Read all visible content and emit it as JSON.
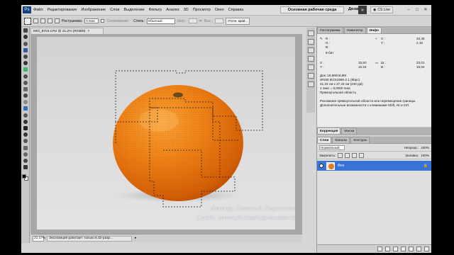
{
  "menubar": {
    "logo": "Ps",
    "items": [
      "Файл",
      "Редактирование",
      "Изображение",
      "Слои",
      "Выделение",
      "Фильтр",
      "Анализ",
      "3D",
      "Просмотр",
      "Окно",
      "Справка"
    ],
    "zoom": "21,2",
    "workspace": "Основная рабочая среда",
    "design": "Дизайн",
    "expand_arrow": "»",
    "cs_live": "CS Live"
  },
  "options": {
    "feather_label": "Растушевка:",
    "feather_value": "0 пикс",
    "antialias_label": "Сглаживание",
    "style_label": "Стиль:",
    "style_value": "Обычный",
    "width_label": "Шир.:",
    "height_label": "Выс.:",
    "refine_button": "Уточн. край..."
  },
  "document": {
    "tab_title": "IMG_8704.CR2 @ 21,2% (RGB/8)",
    "close": "×",
    "status_zoom": "21,17%",
    "status_text": "Экспозиция работает только в 32-разр..."
  },
  "panels": {
    "top_tabs": [
      "Гистограмма",
      "Навигатор",
      "Инфо"
    ],
    "active_top_tab": "Инфо",
    "info": {
      "rgb_block": "R :\nG :\nB :",
      "bit_label": "8-бит",
      "xy_block": "X :\nY :",
      "xy_values": "34,35\n2,15",
      "size_values": "15,50\n15,24",
      "wh_block": "Ш :\nВ :",
      "wh_values": "23,01\n16,04",
      "doc_lines": "Док: 18,8M/18,8M\nsRGB IEC61966-2.1 (8bpc)\n41,15 см x 27,43 см (240 ppi)\n1 пикс = 0,0000 пикс\nПрямоугольная область",
      "hint_lines": "Рисование прямоугольной области или перемещение границы.\nДополнительные возможности с клавишами Shift, Alt и Ctrl."
    },
    "corr_tabs": [
      "Коррекция",
      "Маски"
    ],
    "layer_tabs": [
      "Слои",
      "Каналы",
      "Контуры"
    ],
    "blend_mode": "Нормальный",
    "opacity_label": "Непрозр.:",
    "opacity_value": "100%",
    "lock_label": "Закрепить:",
    "fill_label": "Заливка:",
    "fill_value": "100%",
    "layer_name": "Фон"
  },
  "watermark": {
    "author": "Автор: Евгений Карташов",
    "site": "Сайт: www.photoshop-master.ru"
  },
  "colors": {
    "orange": "#e97a12",
    "selection_layer": "#3874d8",
    "ps_blue": "#1a3d7c"
  }
}
